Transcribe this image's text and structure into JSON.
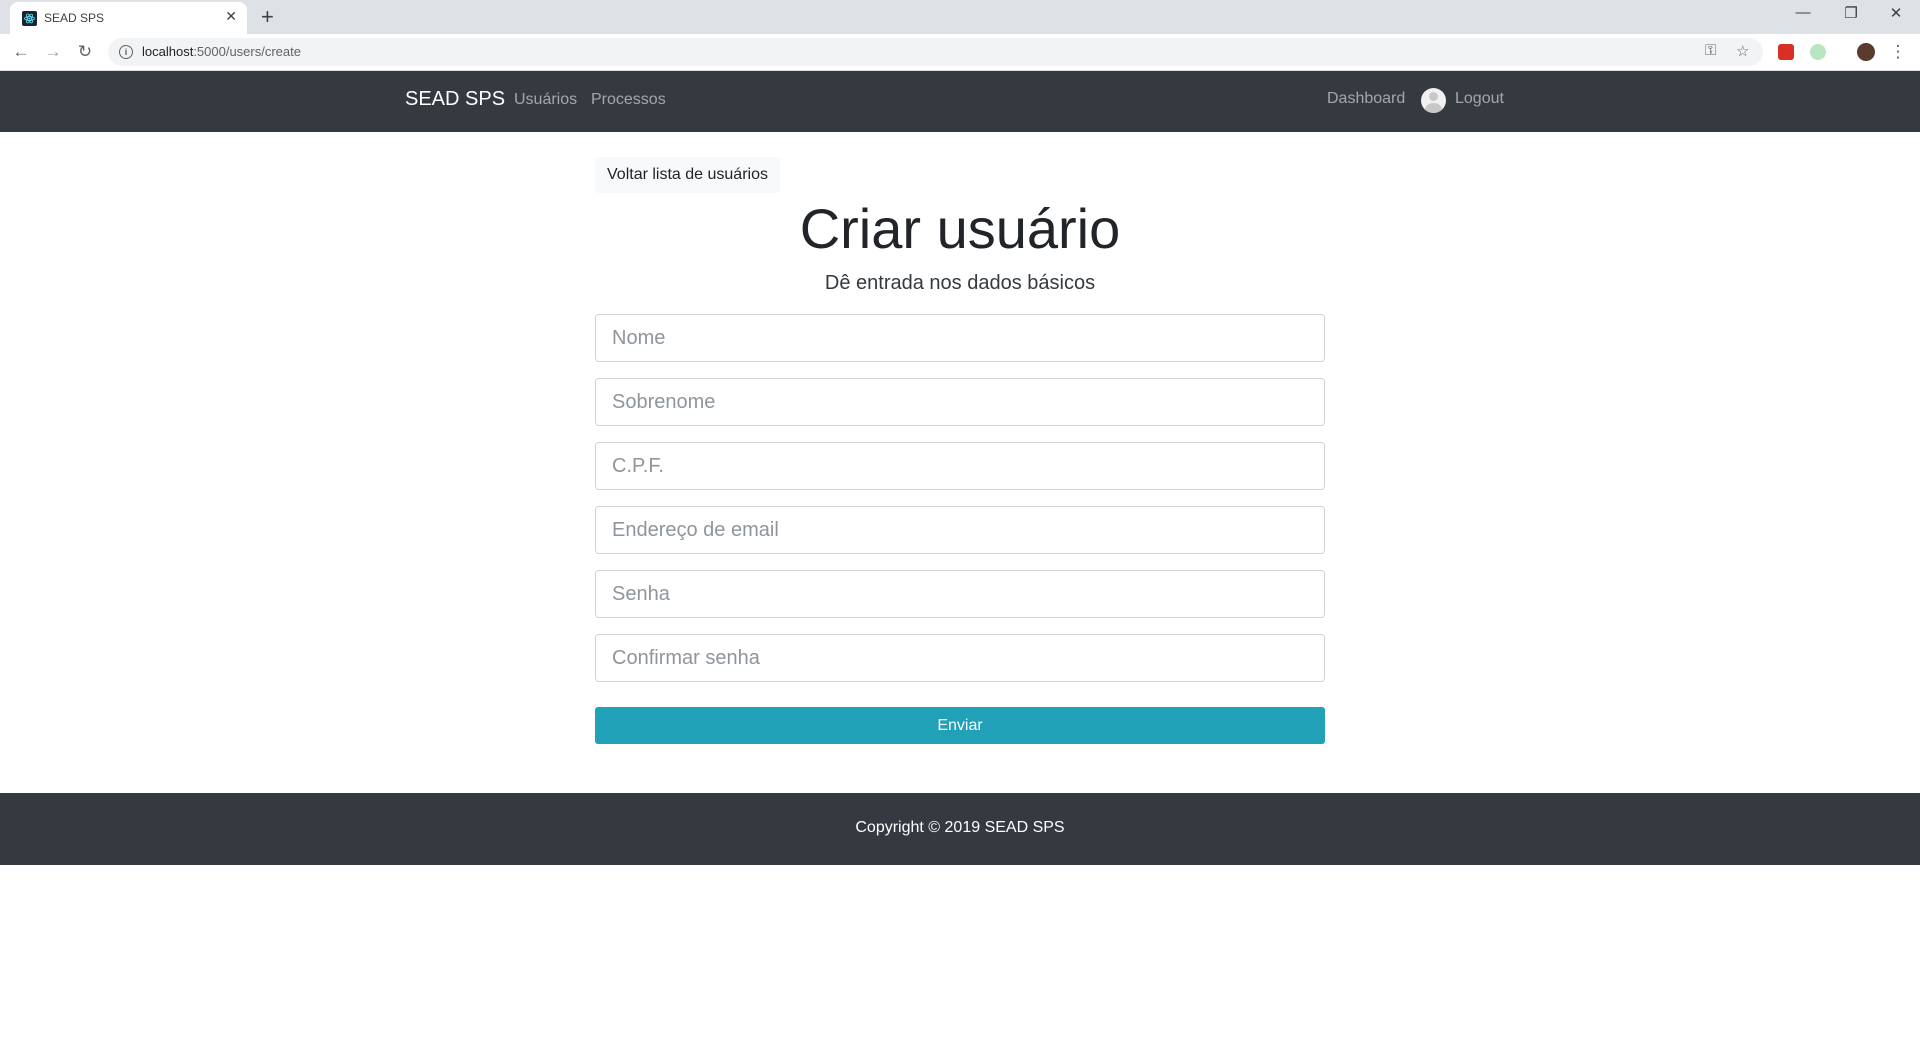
{
  "browser": {
    "tab_title": "SEAD SPS",
    "url_host": "localhost",
    "url_path": ":5000/users/create"
  },
  "navbar": {
    "brand": "SEAD SPS",
    "links": [
      "Usuários",
      "Processos"
    ],
    "right_links": {
      "dashboard": "Dashboard",
      "logout": "Logout"
    }
  },
  "main": {
    "back_button": "Voltar lista de usuários",
    "title": "Criar usuário",
    "subtitle": "Dê entrada nos dados básicos",
    "fields": [
      {
        "placeholder": "Nome",
        "value": ""
      },
      {
        "placeholder": "Sobrenome",
        "value": ""
      },
      {
        "placeholder": "C.P.F.",
        "value": ""
      },
      {
        "placeholder": "Endereço de email",
        "value": ""
      },
      {
        "placeholder": "Senha",
        "value": ""
      },
      {
        "placeholder": "Confirmar senha",
        "value": ""
      }
    ],
    "submit": "Enviar"
  },
  "footer": {
    "copyright": "Copyright © 2019 SEAD SPS"
  },
  "colors": {
    "navbar_bg": "#343a40",
    "submit_bg": "#21a1b8",
    "back_button_bg": "#f8f9fa"
  }
}
